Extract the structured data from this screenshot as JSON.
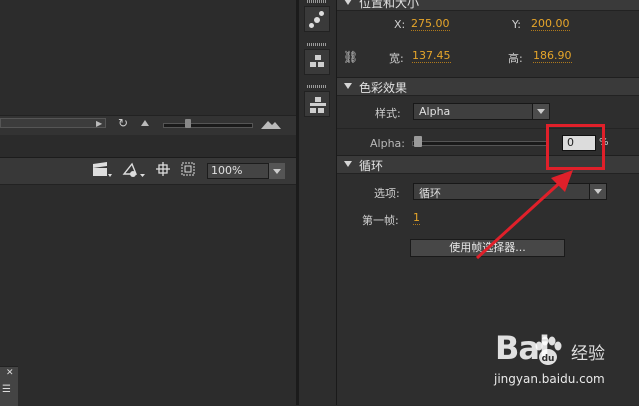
{
  "stage": {
    "zoom_value": "100%"
  },
  "position_size": {
    "section_title": "位置和大小",
    "x_label": "X:",
    "x_value": "275.00",
    "y_label": "Y:",
    "y_value": "200.00",
    "width_label": "宽:",
    "width_value": "137.45",
    "height_label": "高:",
    "height_value": "186.90"
  },
  "color_effect": {
    "section_title": "色彩效果",
    "style_label": "样式:",
    "style_value": "Alpha",
    "alpha_label": "Alpha:",
    "alpha_value": "0",
    "alpha_unit": "%",
    "alpha_level": 0
  },
  "loop": {
    "section_title": "循环",
    "option_label": "选项:",
    "option_value": "循环",
    "first_frame_label": "第一帧:",
    "first_frame_value": "1",
    "frame_picker_button": "使用帧选择器..."
  },
  "watermark": {
    "brand_left": "Bai",
    "brand_right": "经验",
    "url": "jingyan.baidu.com"
  },
  "colors": {
    "accent_value": "#e6a52a",
    "highlight": "#e0202a",
    "panel_bg": "#2e2e2e"
  }
}
